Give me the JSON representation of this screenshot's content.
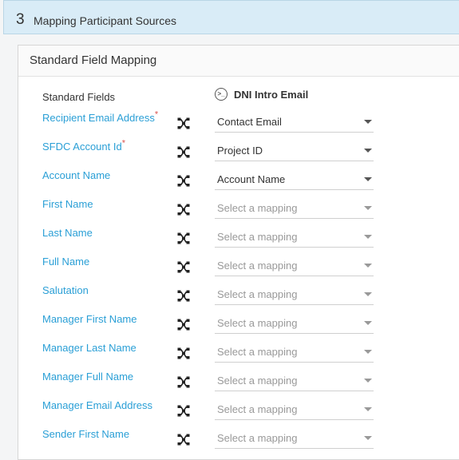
{
  "step": {
    "number": "3",
    "title": "Mapping Participant Sources"
  },
  "panel": {
    "title": "Standard Field Mapping"
  },
  "columns": {
    "fields": "Standard Fields",
    "source": "DNI Intro Email"
  },
  "rows": [
    {
      "label": "Recipient Email Address",
      "required": true,
      "value": "Contact Email",
      "placeholder": false
    },
    {
      "label": "SFDC Account Id",
      "required": true,
      "value": "Project ID",
      "placeholder": false
    },
    {
      "label": "Account Name",
      "required": false,
      "value": "Account Name",
      "placeholder": false
    },
    {
      "label": "First Name",
      "required": false,
      "value": "Select a mapping",
      "placeholder": true
    },
    {
      "label": "Last Name",
      "required": false,
      "value": "Select a mapping",
      "placeholder": true
    },
    {
      "label": "Full Name",
      "required": false,
      "value": "Select a mapping",
      "placeholder": true
    },
    {
      "label": "Salutation",
      "required": false,
      "value": "Select a mapping",
      "placeholder": true
    },
    {
      "label": "Manager First Name",
      "required": false,
      "value": "Select a mapping",
      "placeholder": true
    },
    {
      "label": "Manager Last Name",
      "required": false,
      "value": "Select a mapping",
      "placeholder": true
    },
    {
      "label": "Manager Full Name",
      "required": false,
      "value": "Select a mapping",
      "placeholder": true
    },
    {
      "label": "Manager Email Address",
      "required": false,
      "value": "Select a mapping",
      "placeholder": true
    },
    {
      "label": "Sender First Name",
      "required": false,
      "value": "Select a mapping",
      "placeholder": true
    }
  ],
  "required_marker": "*",
  "icons": {
    "mapping": "shuffle-mapping-icon",
    "source": "email-source-icon",
    "dropdown": "chevron-down-icon"
  },
  "colors": {
    "label": "#2a9fd6",
    "required": "#d9534f",
    "header_bg": "#d9ecf7"
  }
}
